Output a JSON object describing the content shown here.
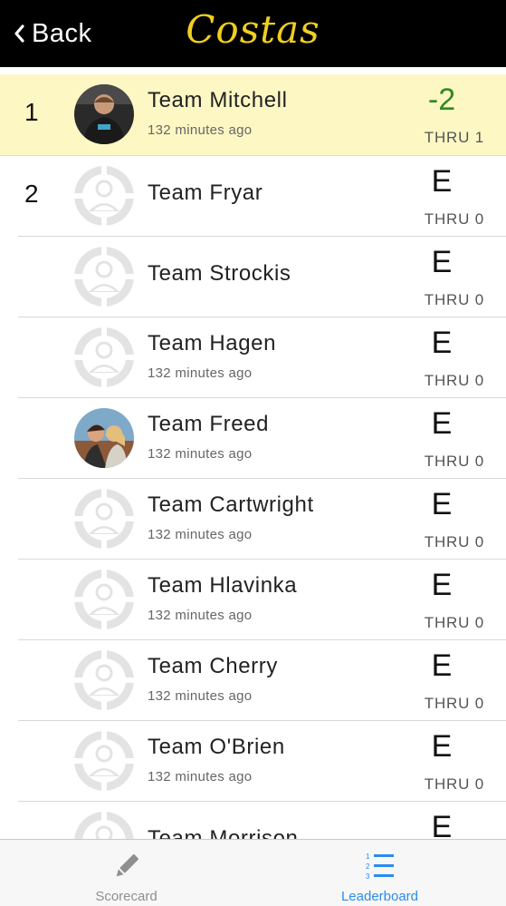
{
  "nav": {
    "back_label": "Back",
    "logo_text": "Costas"
  },
  "leaderboard": [
    {
      "rank": "1",
      "team": "Team Mitchell",
      "time": "132 minutes ago",
      "score": "-2",
      "thru": "THRU 1",
      "avatar": "photo",
      "highlight": true
    },
    {
      "rank": "2",
      "team": "Team Fryar",
      "time": "",
      "score": "E",
      "thru": "THRU 0",
      "avatar": "placeholder",
      "highlight": false
    },
    {
      "rank": "",
      "team": "Team Strockis",
      "time": "",
      "score": "E",
      "thru": "THRU 0",
      "avatar": "placeholder",
      "highlight": false
    },
    {
      "rank": "",
      "team": "Team Hagen",
      "time": "132 minutes ago",
      "score": "E",
      "thru": "THRU 0",
      "avatar": "placeholder",
      "highlight": false
    },
    {
      "rank": "",
      "team": "Team Freed",
      "time": "132 minutes ago",
      "score": "E",
      "thru": "THRU 0",
      "avatar": "photo",
      "highlight": false
    },
    {
      "rank": "",
      "team": "Team Cartwright",
      "time": "132 minutes ago",
      "score": "E",
      "thru": "THRU 0",
      "avatar": "placeholder",
      "highlight": false
    },
    {
      "rank": "",
      "team": "Team Hlavinka",
      "time": "132 minutes ago",
      "score": "E",
      "thru": "THRU 0",
      "avatar": "placeholder",
      "highlight": false
    },
    {
      "rank": "",
      "team": "Team Cherry",
      "time": "132 minutes ago",
      "score": "E",
      "thru": "THRU 0",
      "avatar": "placeholder",
      "highlight": false
    },
    {
      "rank": "",
      "team": "Team O'Brien",
      "time": "132 minutes ago",
      "score": "E",
      "thru": "THRU 0",
      "avatar": "placeholder",
      "highlight": false
    },
    {
      "rank": "",
      "team": "Team Morrison",
      "time": "",
      "score": "E",
      "thru": "",
      "avatar": "placeholder",
      "highlight": false
    }
  ],
  "tabbar": {
    "scorecard_label": "Scorecard",
    "leaderboard_label": "Leaderboard",
    "active": "leaderboard"
  },
  "colors": {
    "header_bg": "#000000",
    "logo": "#f0cf1f",
    "highlight_row": "#fdf7c4",
    "under_par": "#2f8a22",
    "active_tab": "#2b8cf0",
    "inactive_tab": "#8f8f8f"
  },
  "icons": {
    "back": "chevron-left-icon",
    "scorecard": "pencil-icon",
    "leaderboard": "numbered-list-icon",
    "avatar_placeholder": "user-placeholder-icon"
  }
}
